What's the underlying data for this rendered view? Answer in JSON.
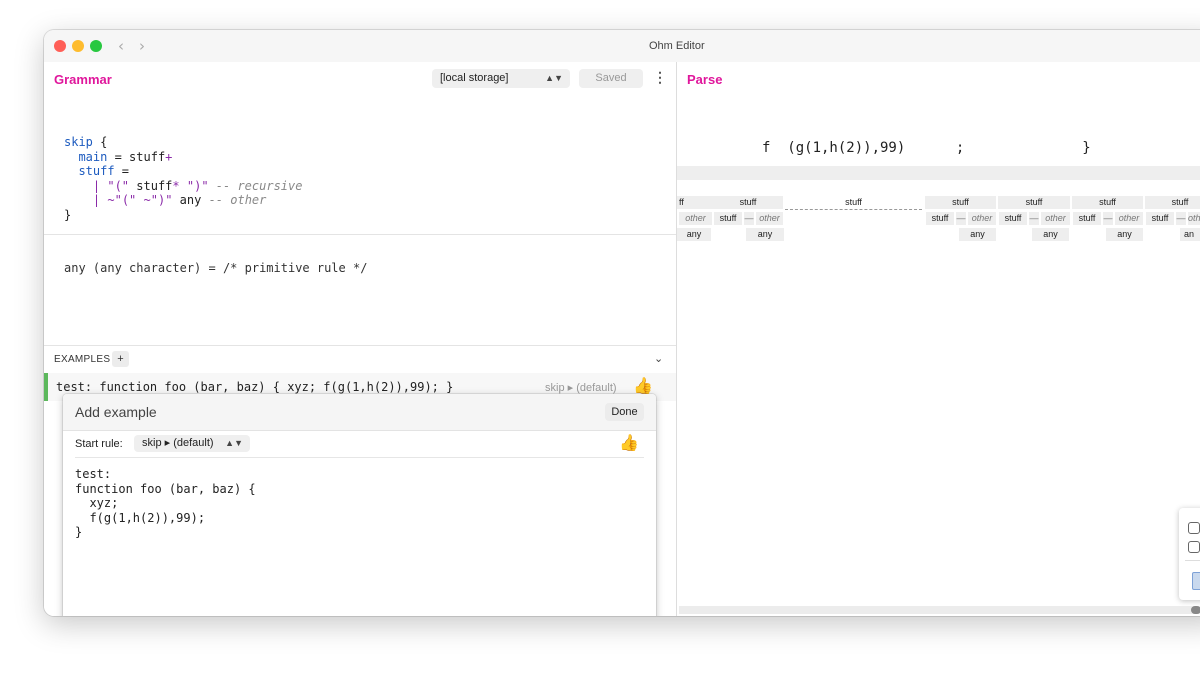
{
  "window": {
    "title": "Ohm Editor"
  },
  "grammar": {
    "title": "Grammar",
    "storage_select": "[local storage]",
    "saved_label": "Saved",
    "code": {
      "l1_kw": "skip",
      "l1_rest": " {",
      "l2_kw": "main",
      "l2_eq": " = ",
      "l2_body": "stuff",
      "l2_op": "+",
      "l3_kw": "stuff",
      "l3_eq": " =",
      "l4_bar": "| ",
      "l4_s1": "\"(\"",
      "l4_mid": " stuff",
      "l4_op": "*",
      "l4_sp": " ",
      "l4_s2": "\")\"",
      "l4_cm": " -- recursive",
      "l5_bar": "| ",
      "l5_op": "~",
      "l5_s1": "\"(\"",
      "l5_sp": " ",
      "l5_op2": "~",
      "l5_s2": "\")\"",
      "l5_mid": " any",
      "l5_cm": " -- other",
      "l6": "}"
    },
    "primitive": "any (any character) = /* primitive rule */"
  },
  "examples": {
    "label": "EXAMPLES",
    "add_label": "+",
    "item_text": "test: function foo (bar, baz) { xyz; f(g(1,h(2)),99); }",
    "item_rule": "skip ▸ (default)"
  },
  "dialog": {
    "title": "Add example",
    "done_label": "Done",
    "start_rule_label": "Start rule:",
    "start_rule_value": "skip ▸ (default)",
    "code_lines": [
      "test:",
      "function foo (bar, baz) {",
      "  xyz;",
      "  f(g(1,h(2)),99);",
      "}"
    ]
  },
  "parse": {
    "title": "Parse",
    "input_text": "f  (g(1,h(2)),99)      ;              }",
    "row1": [
      "ff",
      "stuff",
      "stuff",
      "stuff",
      "stuff",
      "stuff",
      "stuff"
    ],
    "row2": [
      "other",
      "stuff",
      "—",
      "other",
      "stuff",
      "—",
      "other",
      "stuff",
      "—",
      "other",
      "stuff",
      "—",
      "other",
      "stuff",
      "—",
      "oth"
    ],
    "row3": [
      "any",
      "any",
      "any",
      "any",
      "any",
      "an"
    ]
  },
  "colors": {
    "accent": "#e0179c",
    "keyword": "#1d5bbf",
    "string": "#8a2aa8",
    "success": "#5cb85c"
  }
}
